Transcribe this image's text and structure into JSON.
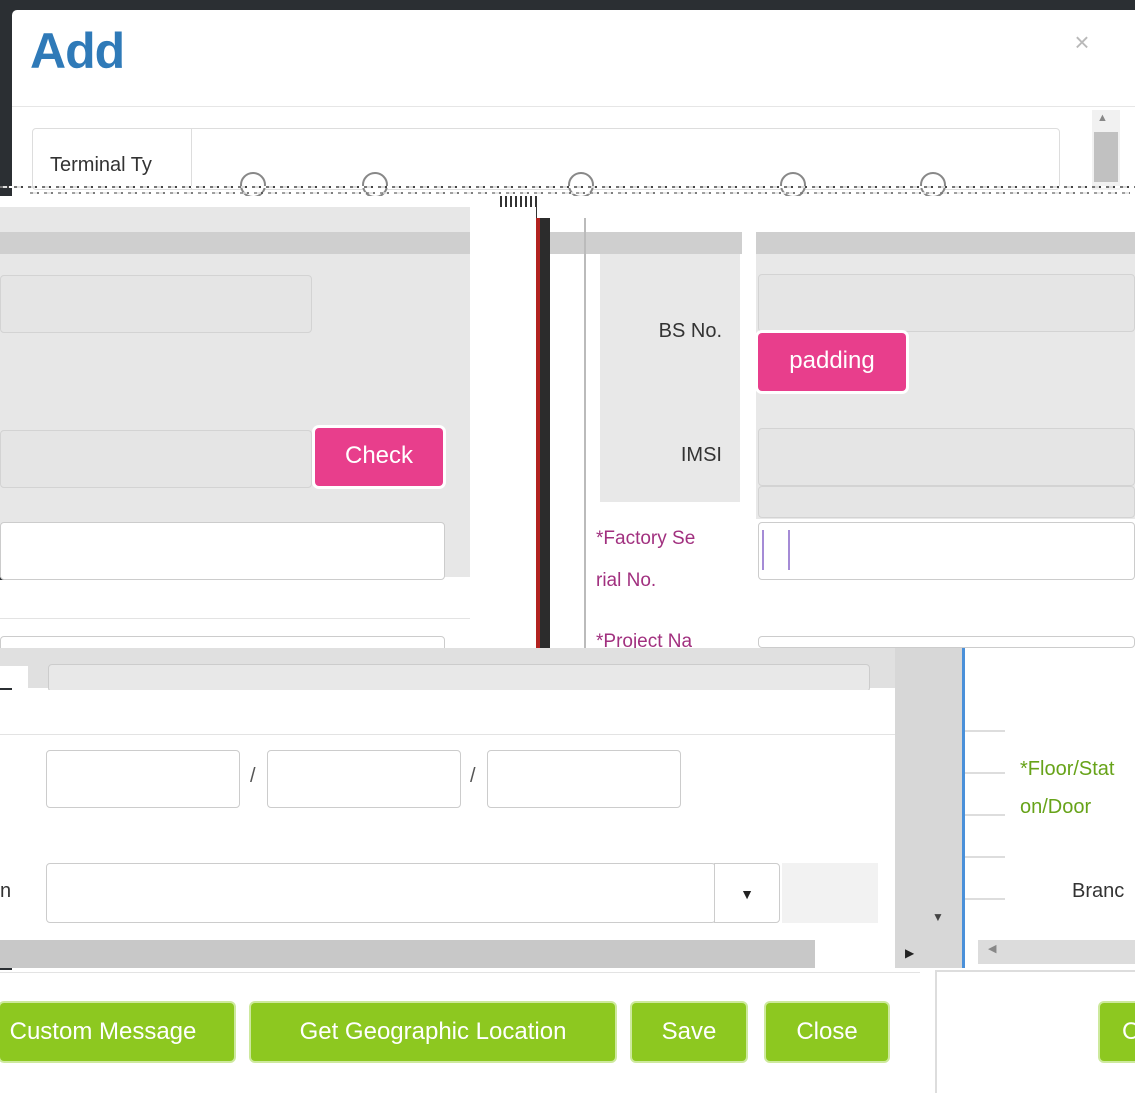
{
  "dialog": {
    "title": "Add",
    "close_glyph": "×"
  },
  "form": {
    "terminal_type_label": "Terminal Ty",
    "bs_no_label": "BS No.",
    "imsi_label": "IMSI",
    "factory_serial_label_1": "*Factory Se",
    "factory_serial_label_2": "rial No.",
    "project_name_label": "*Project Na",
    "floor_label_1": "*Floor/Stat",
    "floor_label_2": "on/Door",
    "branch_label": "Branc",
    "left_partial_label": "n",
    "date_separator_1": "/",
    "date_separator_2": "/"
  },
  "buttons": {
    "check": "Check",
    "padding": "padding",
    "custom_message": "Custom Message",
    "get_geo": "Get Geographic Location",
    "save": "Save",
    "close": "Close",
    "right_partial": "C"
  },
  "icons": {
    "caret": "caret-down-icon",
    "close": "close-icon",
    "scroll_up": "scroll-up-arrow-icon",
    "scroll_down": "scroll-down-arrow-icon",
    "scroll_right": "scroll-right-arrow-icon",
    "scroll_left": "scroll-left-arrow-icon"
  },
  "colors": {
    "title_blue": "#2f7ab8",
    "pink_button": "#e83e8c",
    "green_button": "#8dc820",
    "purple_label": "#a1307f",
    "green_label": "#67a319"
  }
}
